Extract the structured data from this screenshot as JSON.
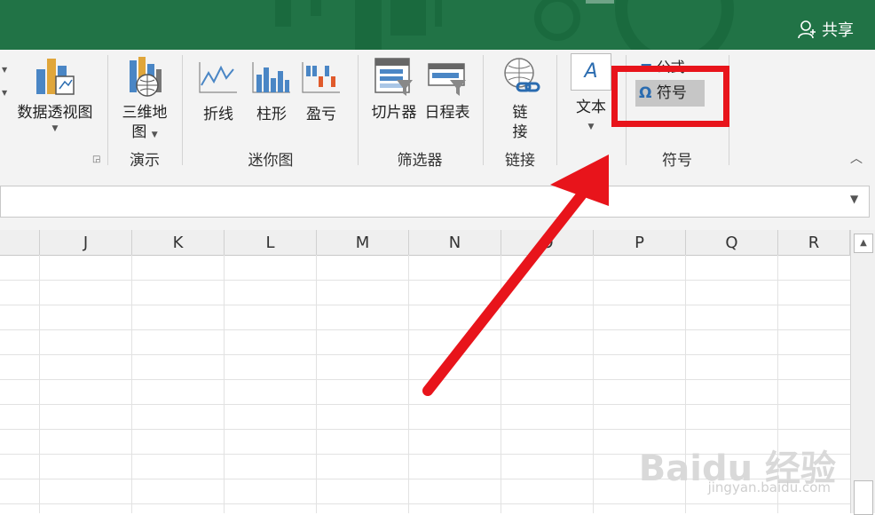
{
  "titlebar": {
    "share_label": "共享"
  },
  "ribbon": {
    "pivot_chart_label": "数据透视图",
    "map3d_label_line1": "三维地",
    "map3d_label_line2": "图",
    "group_tours": "演示",
    "sparkline_line": "折线",
    "sparkline_column": "柱形",
    "sparkline_winloss": "盈亏",
    "group_sparklines": "迷你图",
    "slicer_label": "切片器",
    "timeline_label": "日程表",
    "group_filters": "筛选器",
    "link_label_line1": "链",
    "link_label_line2": "接",
    "group_links": "链接",
    "text_label": "文本",
    "equation_label": "公式",
    "symbol_label": "符号",
    "group_symbols": "符号"
  },
  "columns": [
    "J",
    "K",
    "L",
    "M",
    "N",
    "O",
    "P",
    "Q",
    "R"
  ],
  "watermark": {
    "brand": "Baidu 经验",
    "url": "jingyan.baidu.com"
  }
}
